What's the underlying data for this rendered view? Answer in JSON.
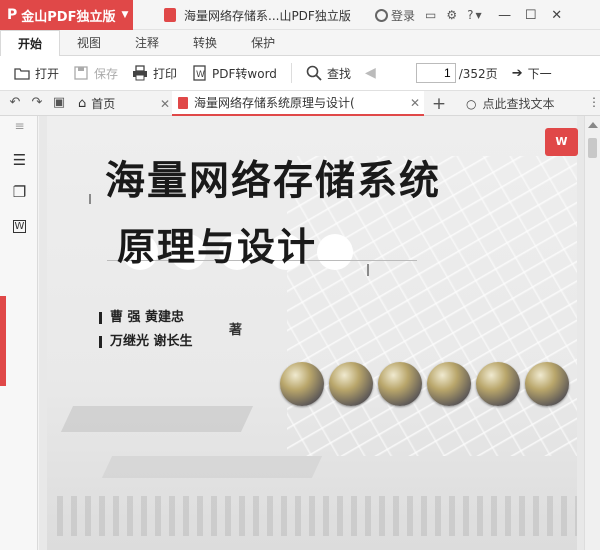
{
  "app": {
    "name": "金山PDF独立版",
    "logo": "P",
    "document_title": "海量网络存储系...山PDF独立版",
    "accent_color": "#e04848"
  },
  "titlebar": {
    "login_label": "登录",
    "help_label": "?"
  },
  "ribbon_tabs": [
    {
      "label": "开始",
      "active": true
    },
    {
      "label": "视图",
      "active": false
    },
    {
      "label": "注释",
      "active": false
    },
    {
      "label": "转换",
      "active": false
    },
    {
      "label": "保护",
      "active": false
    }
  ],
  "toolbar": {
    "open_label": "打开",
    "save_label": "保存",
    "print_label": "打印",
    "pdf2word_label": "PDF转word",
    "find_label": "查找",
    "page_current": "1",
    "page_total": "/352页",
    "next_label": "下一"
  },
  "tabs": {
    "home_label": "首页",
    "doc_label": "海量网络存储系统原理与设计(",
    "search_placeholder": "点此查找文本"
  },
  "page_content": {
    "title_line1": "海量网络存储系统",
    "title_line2": "原理与设计",
    "authors_line1": "曹  强  黄建忠",
    "authors_line2": "万继光  谢长生",
    "author_suffix": "著"
  },
  "float_tool": {
    "icon": "pdf-to-word-icon",
    "label": "W"
  }
}
